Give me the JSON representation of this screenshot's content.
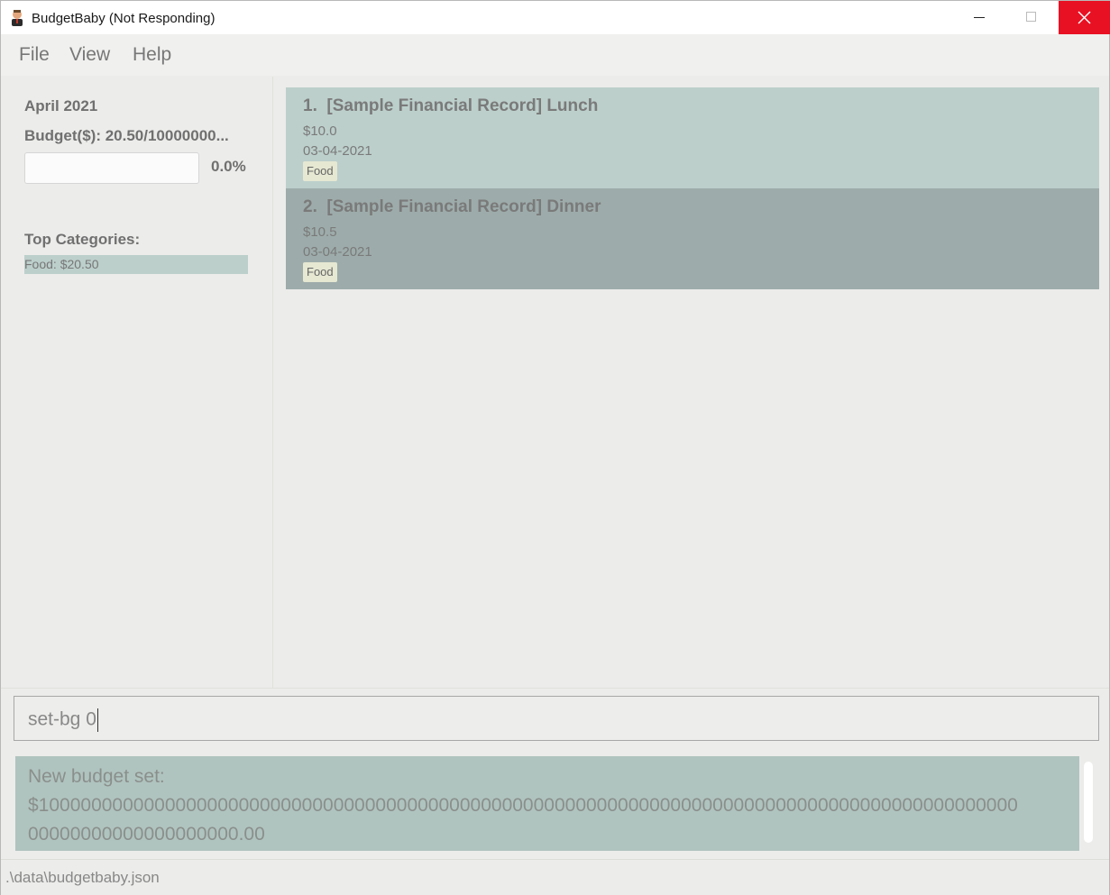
{
  "window": {
    "title": "BudgetBaby (Not Responding)",
    "close_color": "#e81123"
  },
  "menu": {
    "items": [
      "File",
      "View",
      "Help"
    ]
  },
  "summary": {
    "month": "April 2021",
    "budget_text": "Budget($): 20.50/10000000...",
    "progress_fraction": 0.0,
    "progress_label": "0.0%",
    "top_categories_heading": "Top Categories:",
    "categories": [
      "Food: $20.50"
    ]
  },
  "records": [
    {
      "index": "1.",
      "title": "[Sample Financial Record] Lunch",
      "amount": "$10.0",
      "date": "03-04-2021",
      "tag": "Food",
      "background": "#bccfcb"
    },
    {
      "index": "2.",
      "title": "[Sample Financial Record] Dinner",
      "amount": "$10.5",
      "date": "03-04-2021",
      "tag": "Food",
      "background": "#9dacaa"
    }
  ],
  "command": {
    "value": "set-bg 0"
  },
  "result": {
    "line1": "New budget set:",
    "line2": "$100000000000000000000000000000000000000000000000000000000000000000000000000000000000000000000",
    "line3": "00000000000000000000.00"
  },
  "status": {
    "path": ".\\data\\budgetbaby.json"
  }
}
